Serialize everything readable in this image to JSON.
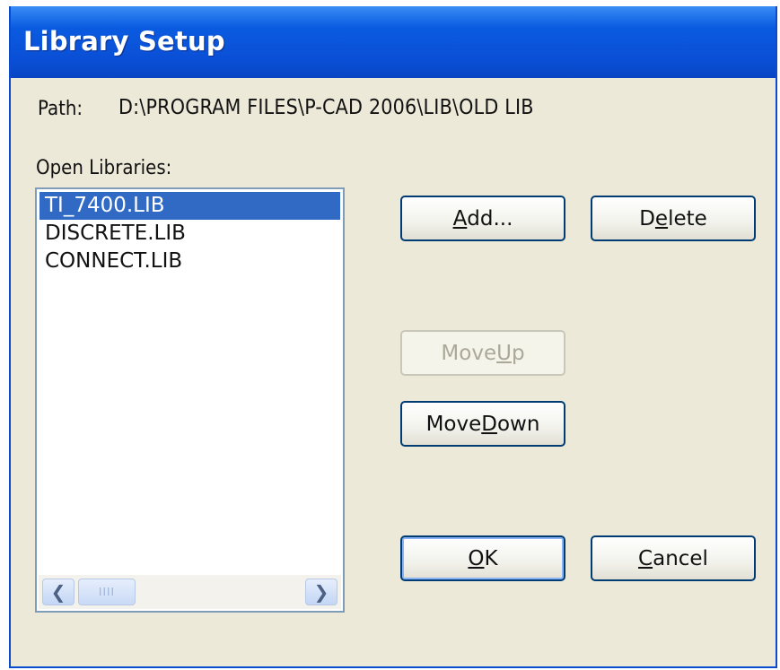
{
  "window": {
    "title": "Library Setup"
  },
  "path": {
    "label": "Path:",
    "value": "D:\\PROGRAM FILES\\P-CAD 2006\\LIB\\OLD LIB"
  },
  "libraries": {
    "label": "Open Libraries:",
    "items": [
      "TI_7400.LIB",
      "DISCRETE.LIB",
      "CONNECT.LIB"
    ],
    "selected": "TI_7400.LIB"
  },
  "scrollbar": {
    "left_icon": "chevron-left-icon",
    "right_icon": "chevron-right-icon",
    "thumb_grip": "IIII"
  },
  "buttons": {
    "add": {
      "pre": "",
      "mnemonic": "A",
      "post": "dd..."
    },
    "delete": {
      "pre": "D",
      "mnemonic": "e",
      "post": "lete"
    },
    "move_up": {
      "pre": "Move ",
      "mnemonic": "U",
      "post": "p"
    },
    "move_down": {
      "pre": "Move ",
      "mnemonic": "D",
      "post": "own"
    },
    "ok": {
      "pre": "",
      "mnemonic": "O",
      "post": "K"
    },
    "cancel": {
      "pre": "",
      "mnemonic": "C",
      "post": "ancel"
    }
  },
  "colors": {
    "titlebar": "#0a4fd6",
    "selection": "#316ac5",
    "dialog_bg": "#ece9d8"
  }
}
